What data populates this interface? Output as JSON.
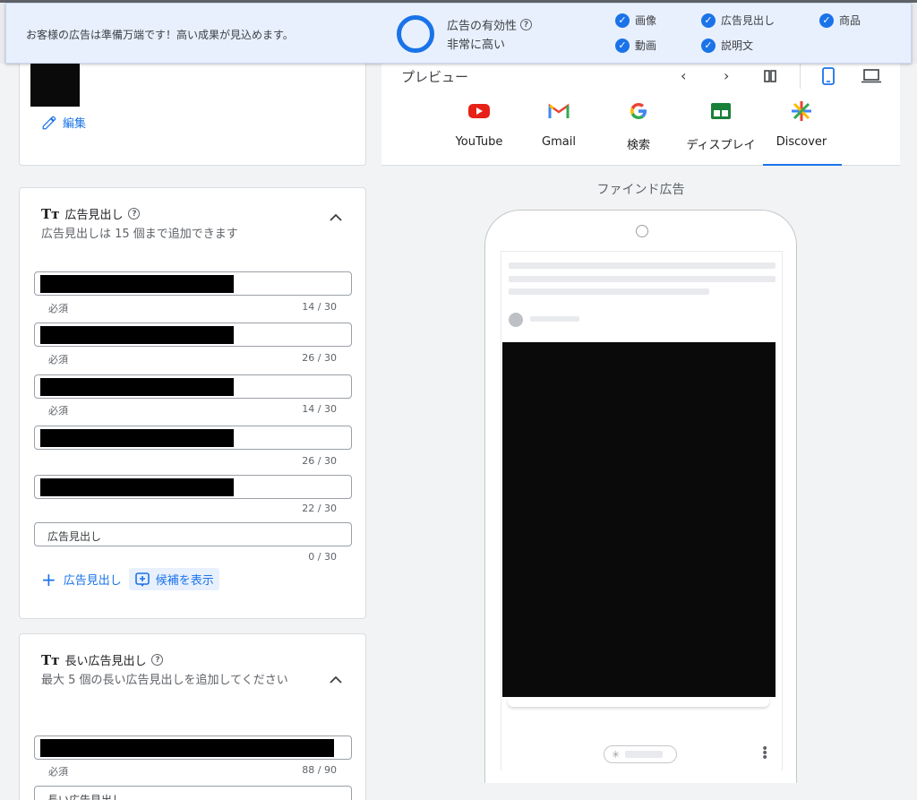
{
  "banner": {
    "message": "お客様の広告は準備万端です！高い成果が見込めます。",
    "effectiveness_label": "広告の有効性",
    "effectiveness_value": "非常に高い",
    "checks": [
      "画像",
      "広告見出し",
      "商品",
      "動画",
      "説明文"
    ]
  },
  "image_card": {
    "edit_label": "編集"
  },
  "headlines": {
    "title": "広告見出し",
    "description": "広告見出しは 15 個まで追加できます",
    "fields": [
      {
        "hint": "必須",
        "count": "14 / 30"
      },
      {
        "hint": "必須",
        "count": "26 / 30"
      },
      {
        "hint": "必須",
        "count": "14 / 30"
      },
      {
        "hint": "",
        "count": "26 / 30"
      },
      {
        "hint": "",
        "count": "22 / 30"
      }
    ],
    "empty_placeholder": "広告見出し",
    "empty_count": "0 / 30",
    "add_label": "広告見出し",
    "suggest_label": "候補を表示"
  },
  "long_headlines": {
    "title": "長い広告見出し",
    "description": "最大 5 個の長い広告見出しを追加してください",
    "field_hint": "必須",
    "field_count": "88 / 90",
    "empty_placeholder": "長い広告見出し"
  },
  "preview": {
    "label": "プレビュー",
    "tabs": [
      "YouTube",
      "Gmail",
      "検索",
      "ディスプレイ",
      "Discover"
    ],
    "active_tab": "Discover",
    "stage_title": "ファインド広告"
  },
  "colors": {
    "accent": "#1a73e8",
    "banner_bg": "#e8f0fe"
  }
}
